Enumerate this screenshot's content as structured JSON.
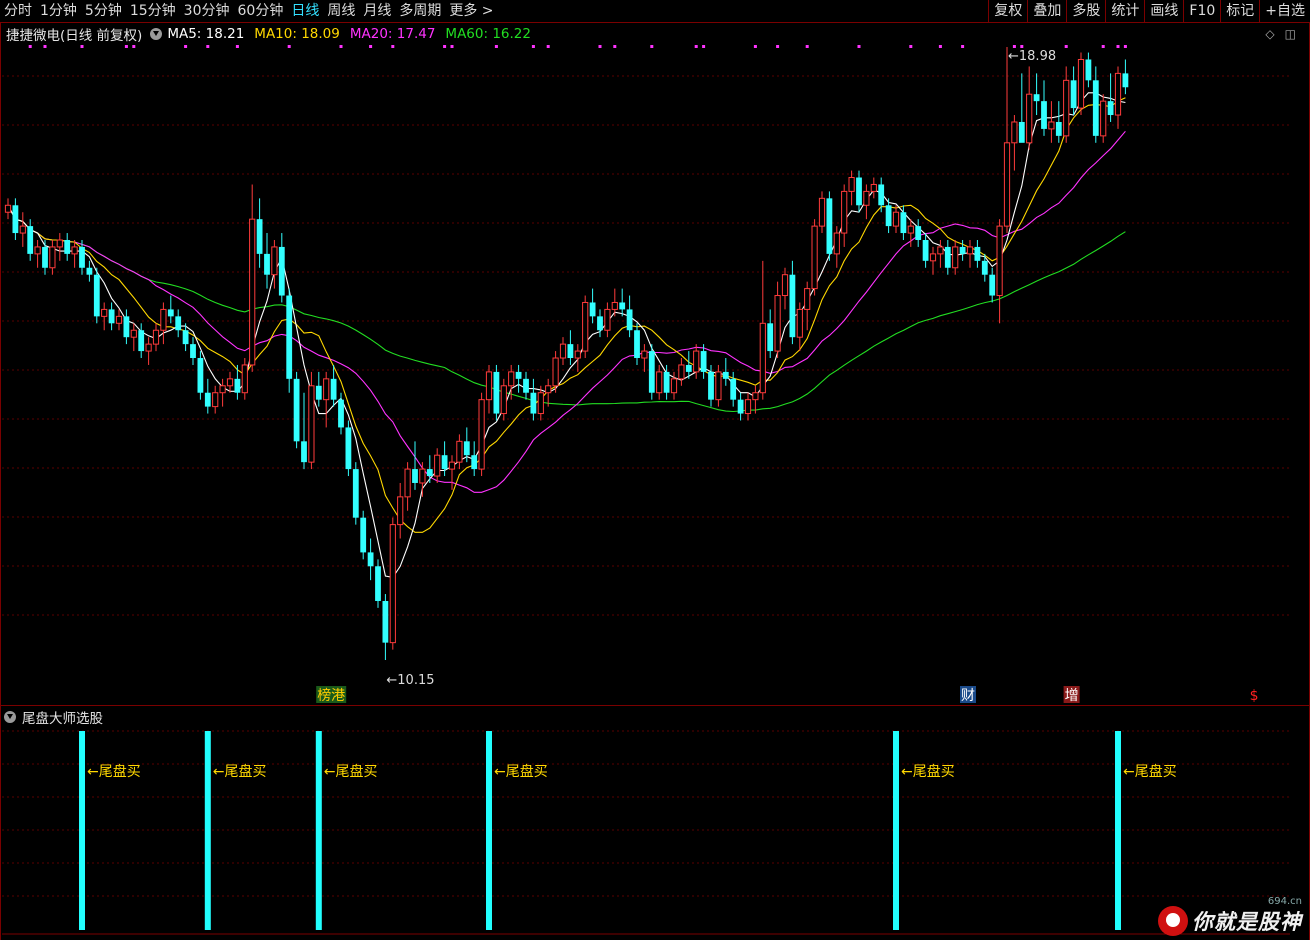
{
  "toolbar": {
    "periods": [
      "分时",
      "1分钟",
      "5分钟",
      "15分钟",
      "30分钟",
      "60分钟",
      "日线",
      "周线",
      "月线",
      "多周期",
      "更多 >"
    ],
    "active": "日线",
    "right_buttons": [
      "复权",
      "叠加",
      "多股",
      "统计",
      "画线",
      "F10",
      "标记",
      "+自选"
    ]
  },
  "title": {
    "stock": "捷捷微电",
    "mode": "(日线 前复权)",
    "ma": [
      {
        "label": "MA5: 18.21",
        "color": "#ffffff"
      },
      {
        "label": "MA10: 18.09",
        "color": "#ffd800"
      },
      {
        "label": "MA20: 17.47",
        "color": "#ff33ff"
      },
      {
        "label": "MA60: 16.22",
        "color": "#22dd22"
      }
    ]
  },
  "indicator": {
    "title": "尾盘大师选股",
    "signal_label": "←尾盘买"
  },
  "markers": {
    "high_label": "←18.98",
    "low_label": "←10.15",
    "events": [
      {
        "text": "榜港",
        "color": "#ffcc00",
        "bg": "#1a5a1a"
      },
      {
        "text": "财",
        "color": "#ffffff",
        "bg": "#1a4a8a"
      },
      {
        "text": "增",
        "color": "#ffffff",
        "bg": "#8a1a1a"
      },
      {
        "text": "$",
        "color": "#ff2020",
        "bg": ""
      }
    ]
  },
  "watermark": {
    "text": "你就是股神",
    "domain": "694.cn"
  },
  "colors": {
    "up": "#ff3b3b",
    "down": "#33ffff",
    "grid": "#5a0000",
    "ma5": "#ffffff",
    "ma10": "#ffd800",
    "ma20": "#ff33ff",
    "ma60": "#22dd22",
    "signal": "#22ffff",
    "signal_text": "#ffd800"
  },
  "chart_data": {
    "type": "candlestick",
    "price_range": [
      10.15,
      18.98
    ],
    "high": 18.98,
    "low": 10.15,
    "ohlc": [
      [
        16.6,
        16.8,
        16.5,
        16.7
      ],
      [
        16.7,
        16.8,
        16.2,
        16.3
      ],
      [
        16.3,
        16.6,
        16.1,
        16.4
      ],
      [
        16.4,
        16.5,
        15.9,
        16.0
      ],
      [
        16.0,
        16.2,
        15.8,
        16.1
      ],
      [
        16.1,
        16.2,
        15.7,
        15.8
      ],
      [
        15.8,
        16.2,
        15.7,
        16.1
      ],
      [
        16.1,
        16.3,
        15.9,
        16.2
      ],
      [
        16.2,
        16.3,
        15.9,
        16.0
      ],
      [
        16.0,
        16.2,
        15.8,
        16.1
      ],
      [
        16.1,
        16.2,
        15.7,
        15.8
      ],
      [
        15.8,
        15.9,
        15.6,
        15.7
      ],
      [
        15.7,
        15.8,
        15.0,
        15.1
      ],
      [
        15.1,
        15.3,
        14.9,
        15.2
      ],
      [
        15.2,
        15.3,
        14.9,
        15.0
      ],
      [
        15.0,
        15.2,
        14.9,
        15.1
      ],
      [
        15.1,
        15.2,
        14.7,
        14.8
      ],
      [
        14.8,
        15.0,
        14.6,
        14.9
      ],
      [
        14.9,
        15.0,
        14.5,
        14.6
      ],
      [
        14.6,
        14.8,
        14.4,
        14.7
      ],
      [
        14.7,
        15.0,
        14.6,
        14.9
      ],
      [
        14.9,
        15.3,
        14.7,
        15.2
      ],
      [
        15.2,
        15.4,
        15.0,
        15.1
      ],
      [
        15.1,
        15.2,
        14.8,
        14.9
      ],
      [
        14.9,
        15.0,
        14.6,
        14.7
      ],
      [
        14.7,
        14.8,
        14.4,
        14.5
      ],
      [
        14.5,
        14.6,
        13.9,
        14.0
      ],
      [
        14.0,
        14.2,
        13.7,
        13.8
      ],
      [
        13.8,
        14.1,
        13.7,
        14.0
      ],
      [
        14.0,
        14.2,
        13.8,
        14.1
      ],
      [
        14.1,
        14.3,
        14.0,
        14.2
      ],
      [
        14.2,
        14.4,
        13.9,
        14.0
      ],
      [
        14.0,
        14.5,
        13.9,
        14.4
      ],
      [
        14.4,
        17.0,
        14.3,
        16.5
      ],
      [
        16.5,
        16.8,
        15.8,
        16.0
      ],
      [
        16.0,
        16.3,
        15.5,
        15.7
      ],
      [
        15.7,
        16.2,
        15.5,
        16.1
      ],
      [
        16.1,
        16.3,
        15.3,
        15.4
      ],
      [
        15.4,
        15.5,
        14.0,
        14.2
      ],
      [
        14.2,
        14.3,
        13.2,
        13.3
      ],
      [
        13.3,
        14.0,
        12.9,
        13.0
      ],
      [
        13.0,
        14.3,
        12.9,
        14.1
      ],
      [
        14.1,
        14.3,
        13.8,
        13.9
      ],
      [
        13.9,
        14.3,
        13.5,
        14.2
      ],
      [
        14.2,
        14.4,
        13.8,
        13.9
      ],
      [
        13.9,
        14.0,
        13.4,
        13.5
      ],
      [
        13.5,
        13.6,
        12.8,
        12.9
      ],
      [
        12.9,
        13.0,
        12.1,
        12.2
      ],
      [
        12.2,
        12.3,
        11.6,
        11.7
      ],
      [
        11.7,
        11.9,
        11.3,
        11.5
      ],
      [
        11.5,
        11.6,
        10.9,
        11.0
      ],
      [
        11.0,
        11.1,
        10.15,
        10.4
      ],
      [
        10.4,
        12.2,
        10.3,
        12.1
      ],
      [
        12.1,
        12.7,
        11.9,
        12.5
      ],
      [
        12.5,
        13.0,
        12.3,
        12.9
      ],
      [
        12.9,
        13.3,
        12.6,
        12.7
      ],
      [
        12.7,
        13.0,
        12.5,
        12.9
      ],
      [
        12.9,
        13.1,
        12.7,
        12.8
      ],
      [
        12.8,
        13.2,
        12.7,
        13.1
      ],
      [
        13.1,
        13.3,
        12.8,
        12.9
      ],
      [
        12.9,
        13.1,
        12.6,
        13.0
      ],
      [
        13.0,
        13.4,
        12.9,
        13.3
      ],
      [
        13.3,
        13.5,
        13.0,
        13.1
      ],
      [
        13.1,
        13.3,
        12.8,
        12.9
      ],
      [
        12.9,
        14.0,
        12.8,
        13.9
      ],
      [
        13.9,
        14.4,
        13.7,
        14.3
      ],
      [
        14.3,
        14.4,
        13.6,
        13.7
      ],
      [
        13.7,
        14.2,
        13.6,
        14.1
      ],
      [
        14.1,
        14.4,
        13.9,
        14.3
      ],
      [
        14.3,
        14.4,
        14.0,
        14.2
      ],
      [
        14.2,
        14.3,
        13.9,
        14.0
      ],
      [
        14.0,
        14.2,
        13.6,
        13.7
      ],
      [
        13.7,
        14.1,
        13.6,
        14.0
      ],
      [
        14.0,
        14.2,
        13.8,
        14.1
      ],
      [
        14.1,
        14.6,
        14.0,
        14.5
      ],
      [
        14.5,
        14.8,
        14.4,
        14.7
      ],
      [
        14.7,
        14.9,
        14.4,
        14.5
      ],
      [
        14.5,
        14.7,
        14.3,
        14.6
      ],
      [
        14.6,
        15.4,
        14.5,
        15.3
      ],
      [
        15.3,
        15.5,
        15.0,
        15.1
      ],
      [
        15.1,
        15.2,
        14.8,
        14.9
      ],
      [
        14.9,
        15.3,
        14.8,
        15.2
      ],
      [
        15.2,
        15.5,
        15.1,
        15.3
      ],
      [
        15.3,
        15.5,
        15.1,
        15.2
      ],
      [
        15.2,
        15.4,
        14.8,
        14.9
      ],
      [
        14.9,
        15.0,
        14.4,
        14.5
      ],
      [
        14.5,
        14.7,
        14.3,
        14.6
      ],
      [
        14.6,
        14.7,
        13.9,
        14.0
      ],
      [
        14.0,
        14.4,
        13.9,
        14.3
      ],
      [
        14.3,
        14.4,
        13.9,
        14.0
      ],
      [
        14.0,
        14.3,
        13.9,
        14.2
      ],
      [
        14.2,
        14.5,
        14.1,
        14.4
      ],
      [
        14.4,
        14.6,
        14.2,
        14.3
      ],
      [
        14.3,
        14.7,
        14.2,
        14.6
      ],
      [
        14.6,
        14.7,
        14.2,
        14.3
      ],
      [
        14.3,
        14.4,
        13.8,
        13.9
      ],
      [
        13.9,
        14.4,
        13.8,
        14.3
      ],
      [
        14.3,
        14.5,
        14.1,
        14.2
      ],
      [
        14.2,
        14.3,
        13.8,
        13.9
      ],
      [
        13.9,
        14.0,
        13.6,
        13.7
      ],
      [
        13.7,
        14.0,
        13.6,
        13.9
      ],
      [
        13.9,
        14.1,
        13.7,
        14.0
      ],
      [
        14.0,
        15.9,
        13.9,
        15.0
      ],
      [
        15.0,
        15.2,
        14.5,
        14.6
      ],
      [
        14.6,
        15.6,
        14.5,
        15.4
      ],
      [
        15.4,
        15.8,
        15.2,
        15.7
      ],
      [
        15.7,
        15.9,
        14.7,
        14.8
      ],
      [
        14.8,
        15.3,
        14.6,
        15.2
      ],
      [
        15.2,
        15.6,
        14.9,
        15.5
      ],
      [
        15.5,
        16.5,
        15.4,
        16.4
      ],
      [
        16.4,
        16.9,
        16.3,
        16.8
      ],
      [
        16.8,
        16.9,
        15.9,
        16.0
      ],
      [
        16.0,
        16.4,
        15.8,
        16.3
      ],
      [
        16.3,
        17.0,
        16.1,
        16.9
      ],
      [
        16.9,
        17.2,
        16.7,
        17.1
      ],
      [
        17.1,
        17.2,
        16.6,
        16.7
      ],
      [
        16.7,
        17.0,
        16.5,
        16.9
      ],
      [
        16.9,
        17.1,
        16.8,
        17.0
      ],
      [
        17.0,
        17.1,
        16.6,
        16.7
      ],
      [
        16.7,
        16.8,
        16.3,
        16.4
      ],
      [
        16.4,
        16.7,
        16.3,
        16.6
      ],
      [
        16.6,
        16.7,
        16.2,
        16.3
      ],
      [
        16.3,
        16.5,
        16.1,
        16.4
      ],
      [
        16.4,
        16.5,
        16.1,
        16.2
      ],
      [
        16.2,
        16.3,
        15.8,
        15.9
      ],
      [
        15.9,
        16.1,
        15.7,
        16.0
      ],
      [
        16.0,
        16.2,
        15.8,
        16.1
      ],
      [
        16.1,
        16.2,
        15.7,
        15.8
      ],
      [
        15.8,
        16.2,
        15.7,
        16.1
      ],
      [
        16.1,
        16.2,
        15.9,
        16.0
      ],
      [
        16.0,
        16.2,
        15.8,
        16.1
      ],
      [
        16.1,
        16.2,
        15.8,
        15.9
      ],
      [
        15.9,
        16.0,
        15.6,
        15.7
      ],
      [
        15.7,
        15.8,
        15.3,
        15.4
      ],
      [
        15.4,
        16.5,
        15.0,
        16.4
      ],
      [
        16.4,
        18.98,
        16.3,
        17.6
      ],
      [
        17.6,
        18.0,
        17.2,
        17.9
      ],
      [
        17.9,
        18.6,
        17.8,
        17.6
      ],
      [
        17.6,
        18.7,
        17.5,
        18.3
      ],
      [
        18.3,
        18.6,
        18.0,
        18.2
      ],
      [
        18.2,
        18.5,
        17.7,
        17.8
      ],
      [
        17.8,
        18.2,
        17.6,
        17.9
      ],
      [
        17.9,
        18.2,
        17.6,
        17.7
      ],
      [
        17.7,
        18.7,
        17.6,
        18.5
      ],
      [
        18.5,
        18.7,
        18.0,
        18.1
      ],
      [
        18.1,
        18.9,
        18.0,
        18.8
      ],
      [
        18.8,
        18.9,
        18.4,
        18.5
      ],
      [
        18.5,
        18.7,
        17.6,
        17.7
      ],
      [
        17.7,
        18.3,
        17.6,
        18.2
      ],
      [
        18.2,
        18.6,
        17.9,
        18.0
      ],
      [
        18.0,
        18.7,
        17.8,
        18.6
      ],
      [
        18.6,
        18.8,
        18.3,
        18.4
      ]
    ],
    "signal_positions": [
      10,
      27,
      42,
      65,
      120,
      150
    ],
    "event_positions": [
      43,
      130,
      144,
      169
    ]
  }
}
